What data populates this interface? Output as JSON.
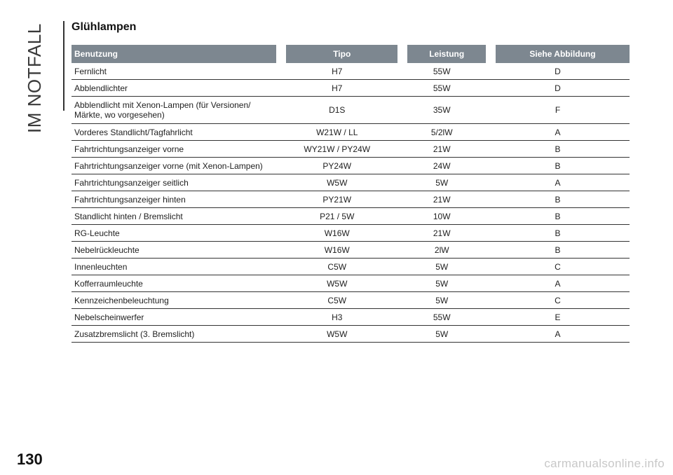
{
  "section": "IM NOTFALL",
  "title": "Glühlampen",
  "table": {
    "headers": [
      "Benutzung",
      "Tipo",
      "Leistung",
      "Siehe Abbildung"
    ],
    "rows": [
      [
        "Fernlicht",
        "H7",
        "55W",
        "D"
      ],
      [
        "Abblendlichter",
        "H7",
        "55W",
        "D"
      ],
      [
        "Abblendlicht mit Xenon-Lampen (für Versionen/ Märkte, wo vorgesehen)",
        "D1S",
        "35W",
        "F"
      ],
      [
        "Vorderes Standlicht/Tagfahrlicht",
        "W21W / LL",
        "5/2lW",
        "A"
      ],
      [
        "Fahrtrichtungsanzeiger vorne",
        "WY21W / PY24W",
        "21W",
        "B"
      ],
      [
        "Fahrtrichtungsanzeiger vorne (mit Xenon-Lampen)",
        "PY24W",
        "24W",
        "B"
      ],
      [
        "Fahrtrichtungsanzeiger seitlich",
        "W5W",
        "5W",
        "A"
      ],
      [
        "Fahrtrichtungsanzeiger hinten",
        "PY21W",
        "21W",
        "B"
      ],
      [
        "Standlicht hinten / Bremslicht",
        "P21 / 5W",
        "10W",
        "B"
      ],
      [
        "RG-Leuchte",
        "W16W",
        "21W",
        "B"
      ],
      [
        "Nebelrückleuchte",
        "W16W",
        "2lW",
        "B"
      ],
      [
        "Innenleuchten",
        "C5W",
        "5W",
        "C"
      ],
      [
        "Kofferraumleuchte",
        "W5W",
        "5W",
        "A"
      ],
      [
        "Kennzeichenbeleuchtung",
        "C5W",
        "5W",
        "C"
      ],
      [
        "Nebelscheinwerfer",
        "H3",
        "55W",
        "E"
      ],
      [
        "Zusatzbremslicht (3. Bremslicht)",
        "W5W",
        "5W",
        "A"
      ]
    ]
  },
  "page_number": "130",
  "watermark": "carmanualsonline.info",
  "colors": {
    "header_background": "#7d8790",
    "rule": "#333333"
  }
}
